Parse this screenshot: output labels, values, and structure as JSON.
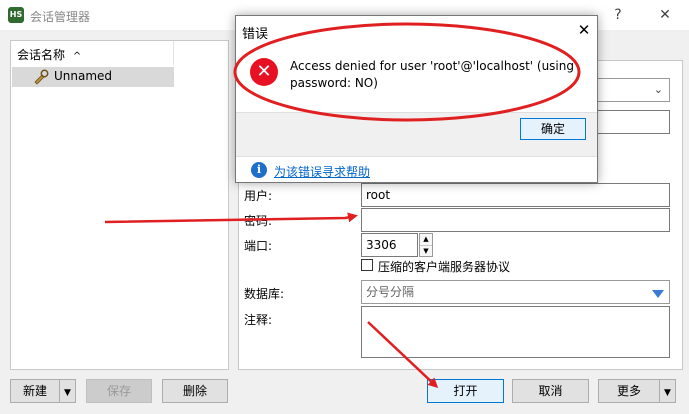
{
  "window": {
    "title": "会话管理器",
    "icon_text": "HS",
    "help_glyph": "?",
    "close_glyph": "✕"
  },
  "session_list": {
    "header": "会话名称",
    "sort_glyph": "^",
    "items": [
      {
        "label": "Unnamed",
        "icon": "session-wrench-icon"
      }
    ]
  },
  "form": {
    "user_label": "用户:",
    "user_value": "root",
    "password_label": "密码:",
    "password_value": "",
    "port_label": "端口:",
    "port_value": "3306",
    "compress_label": "压缩的客户端服务器协议",
    "database_label": "数据库:",
    "database_placeholder": "分号分隔",
    "comment_label": "注释:"
  },
  "buttons": {
    "new": "新建",
    "save": "保存",
    "delete": "删除",
    "open": "打开",
    "cancel": "取消",
    "more": "更多"
  },
  "dialog": {
    "title": "错误",
    "message": "Access denied for user 'root'@'localhost' (using password: NO)",
    "ok": "确定",
    "help_link": "为该错误寻求帮助",
    "error_glyph": "✕",
    "info_glyph": "i"
  },
  "colors": {
    "annotation_red": "#e02020",
    "accent_blue": "#0078d7",
    "error_red": "#e81123"
  }
}
